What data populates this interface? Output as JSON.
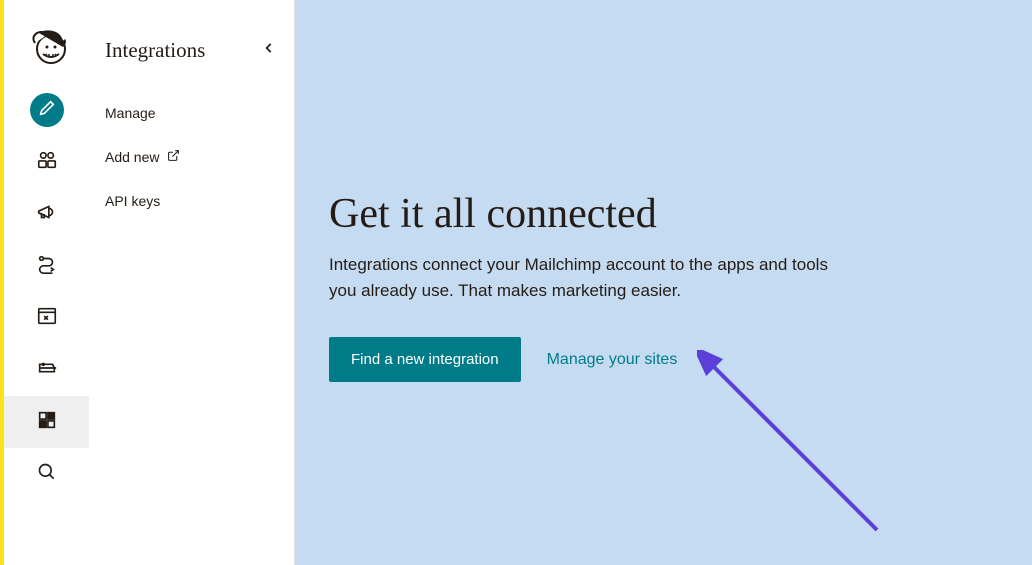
{
  "sidebar": {
    "title": "Integrations",
    "items": [
      {
        "label": "Manage"
      },
      {
        "label": "Add new",
        "external": true
      },
      {
        "label": "API keys"
      }
    ]
  },
  "main": {
    "headline": "Get it all connected",
    "subtext": "Integrations connect your Mailchimp account to the apps and tools you already use. That makes marketing easier.",
    "primary_cta": "Find a new integration",
    "secondary_cta": "Manage your sites"
  },
  "colors": {
    "accent": "#ffe01b",
    "teal": "#007c89",
    "main_bg": "#c5dbf2",
    "arrow": "#5b3fd9"
  }
}
